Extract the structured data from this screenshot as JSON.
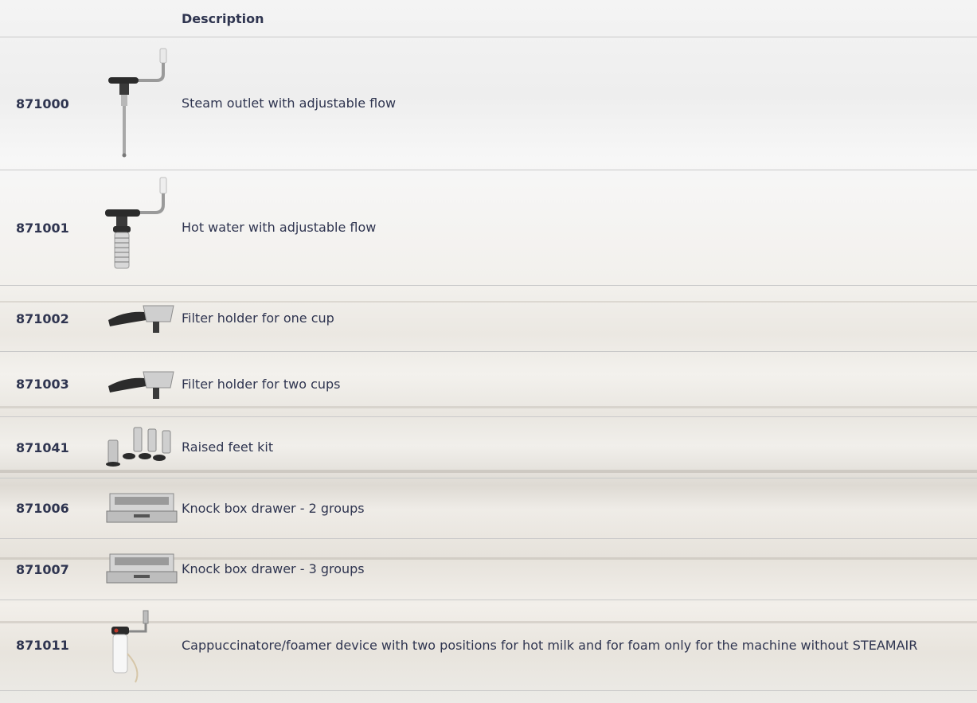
{
  "table": {
    "header": {
      "code": "",
      "image": "",
      "description": "Description"
    },
    "rows": [
      {
        "code": "871000",
        "description": "Steam outlet with adjustable flow",
        "icon": "steam-wand-icon"
      },
      {
        "code": "871001",
        "description": "Hot water with adjustable flow",
        "icon": "hot-water-wand-icon"
      },
      {
        "code": "871002",
        "description": "Filter holder for one cup",
        "icon": "portafilter-icon"
      },
      {
        "code": "871003",
        "description": "Filter holder for two cups",
        "icon": "portafilter-icon"
      },
      {
        "code": "871041",
        "description": "Raised feet kit",
        "icon": "feet-kit-icon"
      },
      {
        "code": "871006",
        "description": "Knock box drawer - 2 groups",
        "icon": "knock-box-icon"
      },
      {
        "code": "871007",
        "description": "Knock box drawer - 3 groups",
        "icon": "knock-box-icon"
      },
      {
        "code": "871011",
        "description": "Cappuccinatore/foamer device with two positions for hot milk and for foam only for the machine without STEAMAIR",
        "icon": "foamer-device-icon"
      }
    ]
  }
}
